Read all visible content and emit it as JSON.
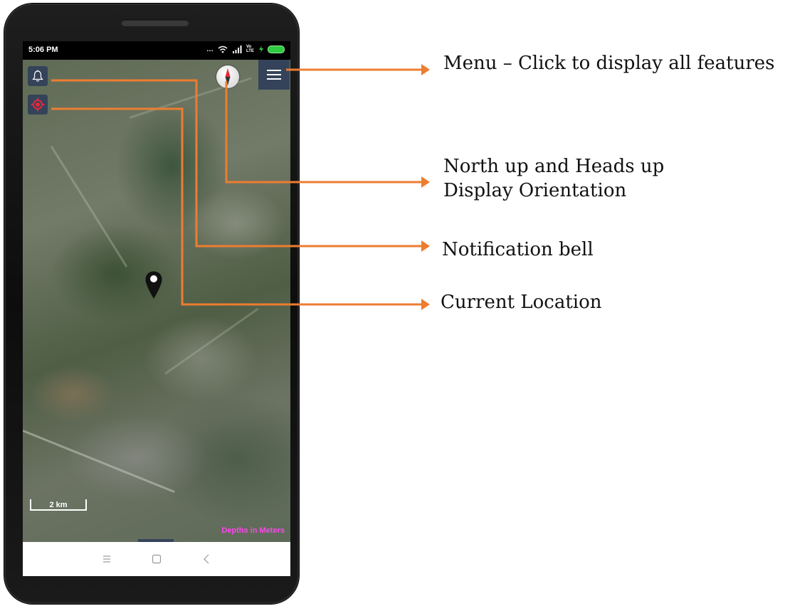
{
  "status_bar": {
    "time": "5:06 PM",
    "network": "Vo LTE",
    "icons": [
      "wifi-icon",
      "signal-icon",
      "charging-icon",
      "battery-icon"
    ]
  },
  "map": {
    "scale_label": "2 km",
    "depth_label": "Depths in Meters",
    "buttons": {
      "notification": "bell-icon",
      "location": "locate-icon",
      "compass": "compass-icon",
      "menu": "hamburger-menu-icon"
    }
  },
  "nav_bar": {
    "icons": [
      "recent-apps-icon",
      "home-icon",
      "back-icon"
    ]
  },
  "annotations": {
    "menu": "Menu – Click to display all features",
    "orientation_line1": "North up and Heads up",
    "orientation_line2": "Display Orientation",
    "notification": "Notification bell",
    "location": "Current Location"
  },
  "colors": {
    "callout": "#ed7d31",
    "button_bg": "#34435a",
    "depth_text": "#ff44ee",
    "battery": "#2ecc40"
  }
}
